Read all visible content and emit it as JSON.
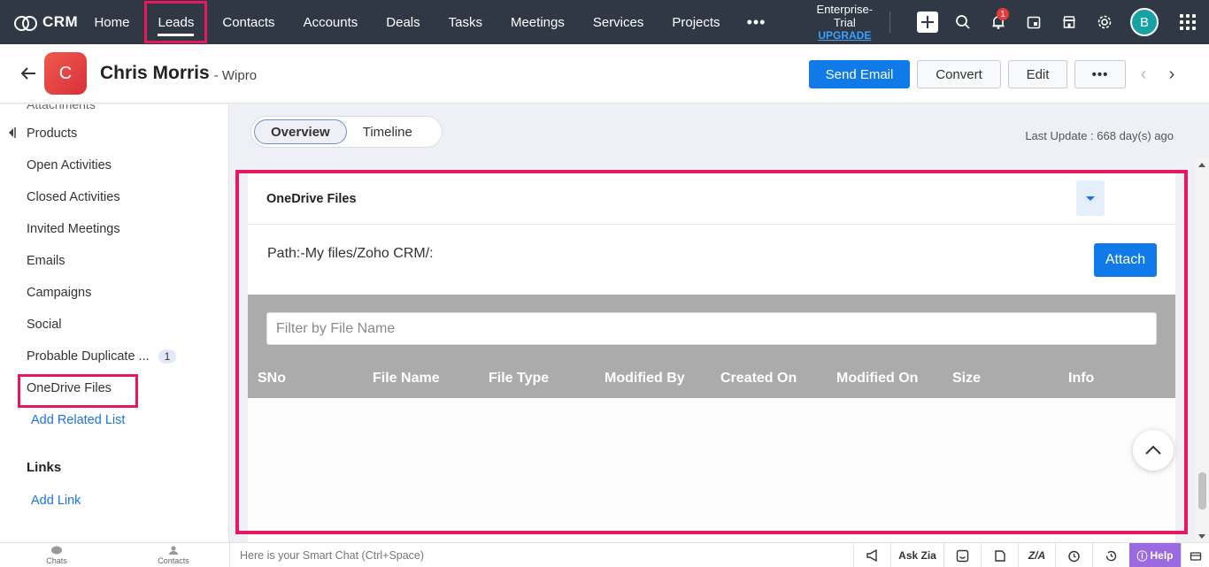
{
  "brand": {
    "name": "CRM"
  },
  "nav": {
    "items": [
      {
        "label": "Home"
      },
      {
        "label": "Leads"
      },
      {
        "label": "Contacts"
      },
      {
        "label": "Accounts"
      },
      {
        "label": "Deals"
      },
      {
        "label": "Tasks"
      },
      {
        "label": "Meetings"
      },
      {
        "label": "Services"
      },
      {
        "label": "Projects"
      }
    ],
    "more_label": "•••",
    "trial_label": "Enterprise-Trial",
    "upgrade_label": "UPGRADE",
    "notification_count": "1",
    "user_initial": "B"
  },
  "record": {
    "initial": "C",
    "name": "Chris Morris",
    "company": "- Wipro",
    "actions": {
      "send_email": "Send Email",
      "convert": "Convert",
      "edit": "Edit",
      "more": "•••"
    }
  },
  "sidebar": {
    "cut_item": "Attachments",
    "items": [
      {
        "label": "Products"
      },
      {
        "label": "Open Activities"
      },
      {
        "label": "Closed Activities"
      },
      {
        "label": "Invited Meetings"
      },
      {
        "label": "Emails"
      },
      {
        "label": "Campaigns"
      },
      {
        "label": "Social"
      },
      {
        "label": "Probable Duplicate ...",
        "count": "1"
      },
      {
        "label": "OneDrive Files"
      }
    ],
    "add_related": "Add Related List",
    "links_heading": "Links",
    "add_link": "Add Link"
  },
  "main": {
    "tabs": [
      {
        "label": "Overview"
      },
      {
        "label": "Timeline"
      }
    ],
    "last_update": "Last Update : 668 day(s) ago",
    "onedrive": {
      "title": "OneDrive Files",
      "path": "Path:-My files/Zoho CRM/:",
      "attach_label": "Attach",
      "filter_placeholder": "Filter by File Name",
      "columns": [
        "SNo",
        "File Name",
        "File Type",
        "Modified By",
        "Created On",
        "Modified On",
        "Size",
        "Info"
      ]
    }
  },
  "bottombar": {
    "chats": "Chats",
    "contacts": "Contacts",
    "smart_chat": "Here is your Smart Chat (Ctrl+Space)",
    "ask_zia": "Ask Zia",
    "help": "Help"
  },
  "colors": {
    "nav_bg": "#303846",
    "primary": "#0f7ae8",
    "highlight": "#e8185c",
    "grey_panel": "#ababab"
  }
}
